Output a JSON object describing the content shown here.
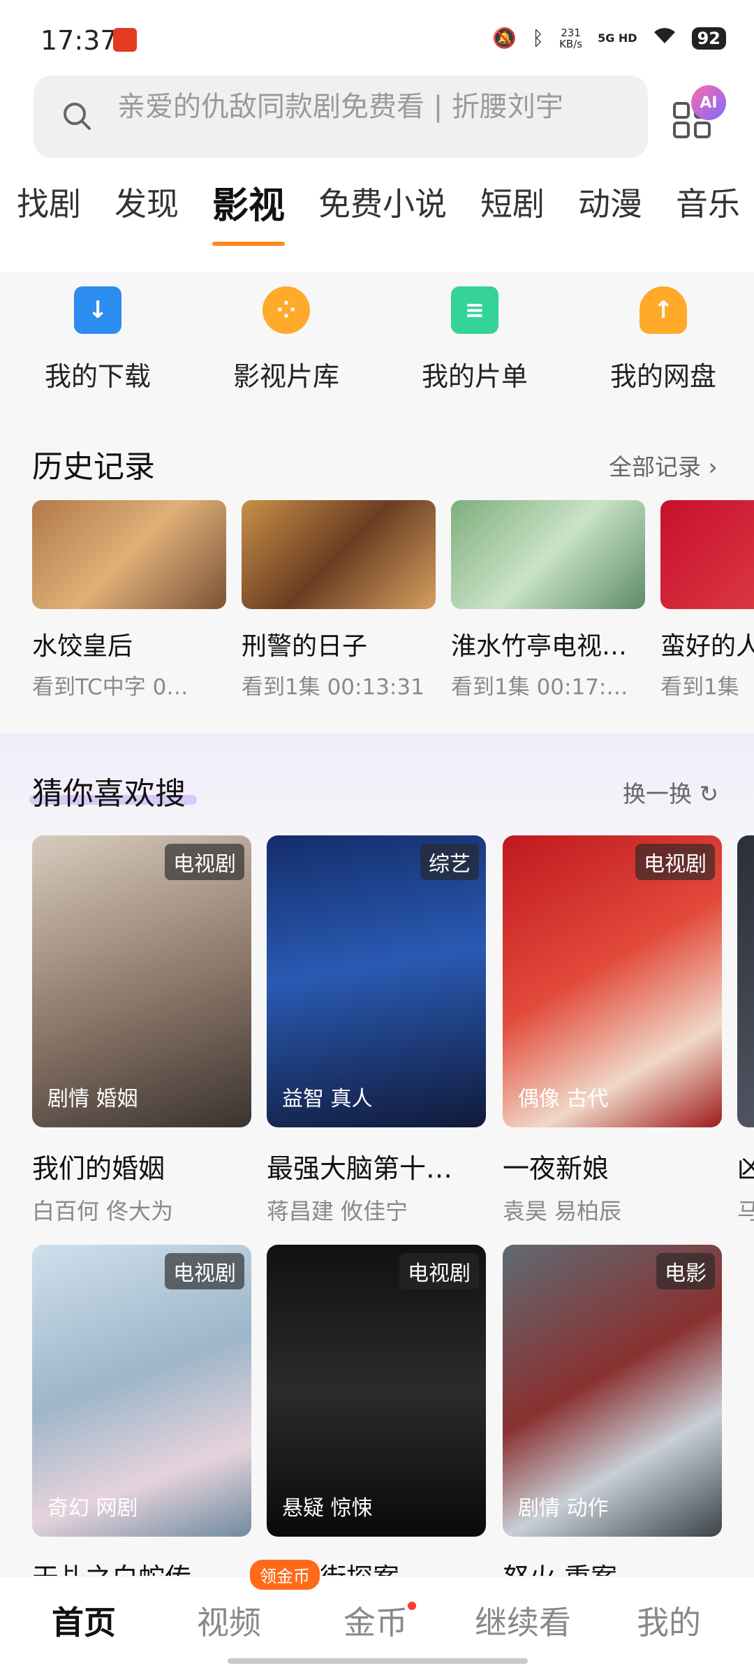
{
  "status_bar": {
    "time": "17:37",
    "net_speed_value": "231",
    "net_speed_unit": "KB/s",
    "signal_label": "5G HD",
    "battery": "92"
  },
  "search": {
    "placeholder": "亲爱的仇敌同款剧免费看 | 折腰刘宇",
    "ai_badge": "AI"
  },
  "tabs": [
    "找剧",
    "发现",
    "影视",
    "免费小说",
    "短剧",
    "动漫",
    "音乐"
  ],
  "active_tab": "影视",
  "shortcuts": [
    {
      "label": "我的下载",
      "icon": "download-icon",
      "color": "#2d8cf0"
    },
    {
      "label": "影视片库",
      "icon": "film-reel-icon",
      "color": "#ffaa2b"
    },
    {
      "label": "我的片单",
      "icon": "list-icon",
      "color": "#34d399"
    },
    {
      "label": "我的网盘",
      "icon": "cloud-upload-icon",
      "color": "#ffaa2b"
    }
  ],
  "history": {
    "title": "历史记录",
    "link": "全部记录",
    "items": [
      {
        "title": "水饺皇后",
        "progress": "看到TC中字 0…"
      },
      {
        "title": "刑警的日子",
        "progress": "看到1集 00:13:31"
      },
      {
        "title": "淮水竹亭电视…",
        "progress": "看到1集 00:17:…"
      },
      {
        "title": "蛮好的人",
        "progress": "看到1集"
      }
    ]
  },
  "guess": {
    "title": "猜你喜欢搜",
    "link": "换一换",
    "cards": [
      {
        "badge": "电视剧",
        "genre": "剧情 婚姻",
        "title": "我们的婚姻",
        "cast": "白百何 佟大为"
      },
      {
        "badge": "综艺",
        "genre": "益智 真人",
        "title": "最强大脑第十…",
        "cast": "蒋昌建 攸佳宁"
      },
      {
        "badge": "电视剧",
        "genre": "偶像 古代",
        "title": "一夜新娘",
        "cast": "袁昊 易柏辰"
      },
      {
        "badge": "",
        "genre": "",
        "title": "凶",
        "cast": "马"
      },
      {
        "badge": "电视剧",
        "genre": "奇幻 网剧",
        "title": "天乩之白蛇传…",
        "cast": ""
      },
      {
        "badge": "电视剧",
        "genre": "悬疑 惊悚",
        "title": "唐人街探案",
        "cast": ""
      },
      {
        "badge": "电影",
        "genre": "剧情 动作",
        "title": "怒火·重案",
        "cast": ""
      }
    ]
  },
  "bottom_nav": {
    "items": [
      "首页",
      "视频",
      "金币",
      "继续看",
      "我的"
    ],
    "active": "首页",
    "coin_badge": "领金币"
  }
}
